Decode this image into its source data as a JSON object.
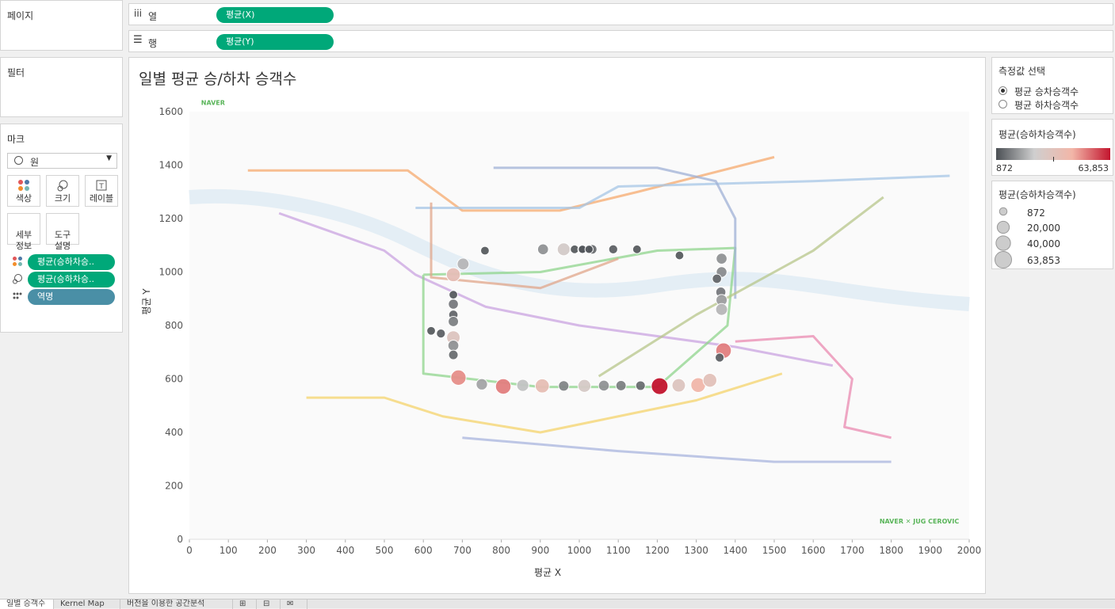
{
  "left_panel": {
    "pages_title": "페이지",
    "filters_title": "필터",
    "marks_title": "마크",
    "mark_type": "원",
    "buttons": [
      {
        "label": "색상",
        "icon": "color-dots-icon"
      },
      {
        "label": "크기",
        "icon": "size-icon"
      },
      {
        "label": "레이블",
        "icon": "label-icon"
      },
      {
        "label": "세부\n정보",
        "icon": ""
      },
      {
        "label": "도구\n설명",
        "icon": ""
      }
    ],
    "mark_fields": [
      {
        "icon": "color-dots-icon",
        "label": "평균(승하차승..",
        "color": "#00a879"
      },
      {
        "icon": "size-icon",
        "label": "평균(승하차승..",
        "color": "#00a879"
      },
      {
        "icon": "detail-icon",
        "label": "역명",
        "color": "#4a8fa6"
      }
    ]
  },
  "shelves": {
    "columns_label": "열",
    "columns_pill": "평균(X)",
    "rows_label": "행",
    "rows_pill": "평균(Y)"
  },
  "view": {
    "title": "일별 평균 승/하차 승객수",
    "map_brand_top": "NAVER",
    "map_brand_bottom": "NAVER ✕ JUG CEROVIC"
  },
  "chart_data": {
    "type": "scatter",
    "title": "일별 평균 승/하차 승객수",
    "xlabel": "평균 X",
    "ylabel": "평균 Y",
    "xlim": [
      0,
      2000
    ],
    "ylim": [
      0,
      1600
    ],
    "x_ticks": [
      0,
      100,
      200,
      300,
      400,
      500,
      600,
      700,
      800,
      900,
      1000,
      1100,
      1200,
      1300,
      1400,
      1500,
      1600,
      1700,
      1800,
      1900,
      2000
    ],
    "y_ticks": [
      0,
      200,
      400,
      600,
      800,
      1000,
      1200,
      1400,
      1600
    ],
    "grid": false,
    "size_measure": "평균(승하차승객수)",
    "color_range": [
      872,
      63853
    ],
    "points": [
      {
        "x": 702,
        "y": 1030,
        "v": 18000
      },
      {
        "x": 677,
        "y": 990,
        "v": 35000
      },
      {
        "x": 677,
        "y": 915,
        "v": 3000
      },
      {
        "x": 677,
        "y": 880,
        "v": 8000
      },
      {
        "x": 677,
        "y": 840,
        "v": 5000
      },
      {
        "x": 677,
        "y": 815,
        "v": 9000
      },
      {
        "x": 677,
        "y": 755,
        "v": 30000
      },
      {
        "x": 677,
        "y": 725,
        "v": 12000
      },
      {
        "x": 677,
        "y": 690,
        "v": 6000
      },
      {
        "x": 690,
        "y": 605,
        "v": 48000
      },
      {
        "x": 750,
        "y": 580,
        "v": 15000
      },
      {
        "x": 805,
        "y": 572,
        "v": 50000
      },
      {
        "x": 855,
        "y": 576,
        "v": 20000
      },
      {
        "x": 905,
        "y": 574,
        "v": 36000
      },
      {
        "x": 960,
        "y": 574,
        "v": 10000
      },
      {
        "x": 1013,
        "y": 574,
        "v": 26000
      },
      {
        "x": 1063,
        "y": 575,
        "v": 12000
      },
      {
        "x": 1107,
        "y": 575,
        "v": 9000
      },
      {
        "x": 1157,
        "y": 575,
        "v": 6000
      },
      {
        "x": 1206,
        "y": 573,
        "v": 63853
      },
      {
        "x": 1255,
        "y": 576,
        "v": 30000
      },
      {
        "x": 1305,
        "y": 577,
        "v": 42000
      },
      {
        "x": 1335,
        "y": 595,
        "v": 33000
      },
      {
        "x": 1370,
        "y": 706,
        "v": 50000
      },
      {
        "x": 1360,
        "y": 680,
        "v": 4000
      },
      {
        "x": 1365,
        "y": 1050,
        "v": 12000
      },
      {
        "x": 1365,
        "y": 1000,
        "v": 11000
      },
      {
        "x": 1363,
        "y": 925,
        "v": 8000
      },
      {
        "x": 1365,
        "y": 895,
        "v": 14000
      },
      {
        "x": 1365,
        "y": 860,
        "v": 18000
      },
      {
        "x": 1353,
        "y": 975,
        "v": 5000
      },
      {
        "x": 907,
        "y": 1085,
        "v": 12000
      },
      {
        "x": 960,
        "y": 1085,
        "v": 25000
      },
      {
        "x": 988,
        "y": 1085,
        "v": 3000
      },
      {
        "x": 1008,
        "y": 1085,
        "v": 5000
      },
      {
        "x": 1033,
        "y": 1085,
        "v": 6000
      },
      {
        "x": 1087,
        "y": 1085,
        "v": 4000
      },
      {
        "x": 1148,
        "y": 1085,
        "v": 3000
      },
      {
        "x": 1008,
        "y": 1085,
        "v": 2000
      },
      {
        "x": 1257,
        "y": 1062,
        "v": 3000
      },
      {
        "x": 758,
        "y": 1080,
        "v": 3000
      },
      {
        "x": 620,
        "y": 780,
        "v": 3000
      },
      {
        "x": 645,
        "y": 770,
        "v": 4000
      },
      {
        "x": 1025,
        "y": 1085,
        "v": 2000
      }
    ]
  },
  "legends": {
    "measure_select_title": "측정값 선택",
    "measure_options": [
      {
        "label": "평균 승차승객수",
        "selected": true
      },
      {
        "label": "평균 하차승객수",
        "selected": false
      }
    ],
    "color_title": "평균(승하차승객수)",
    "color_min": "872",
    "color_max": "63,853",
    "color_stops": [
      "#4b4f54",
      "#cfcfcf",
      "#f2b6a8",
      "#c3152e"
    ],
    "size_title": "평균(승하차승객수)",
    "size_items": [
      {
        "label": "872",
        "value": 872
      },
      {
        "label": "20,000",
        "value": 20000
      },
      {
        "label": "40,000",
        "value": 40000
      },
      {
        "label": "63,853",
        "value": 63853
      }
    ]
  },
  "tabs": [
    {
      "label": "일별 승객수",
      "active": true
    },
    {
      "label": "Kernel Map",
      "active": false
    },
    {
      "label": "버전을 이용한 공간분석",
      "active": false
    }
  ]
}
